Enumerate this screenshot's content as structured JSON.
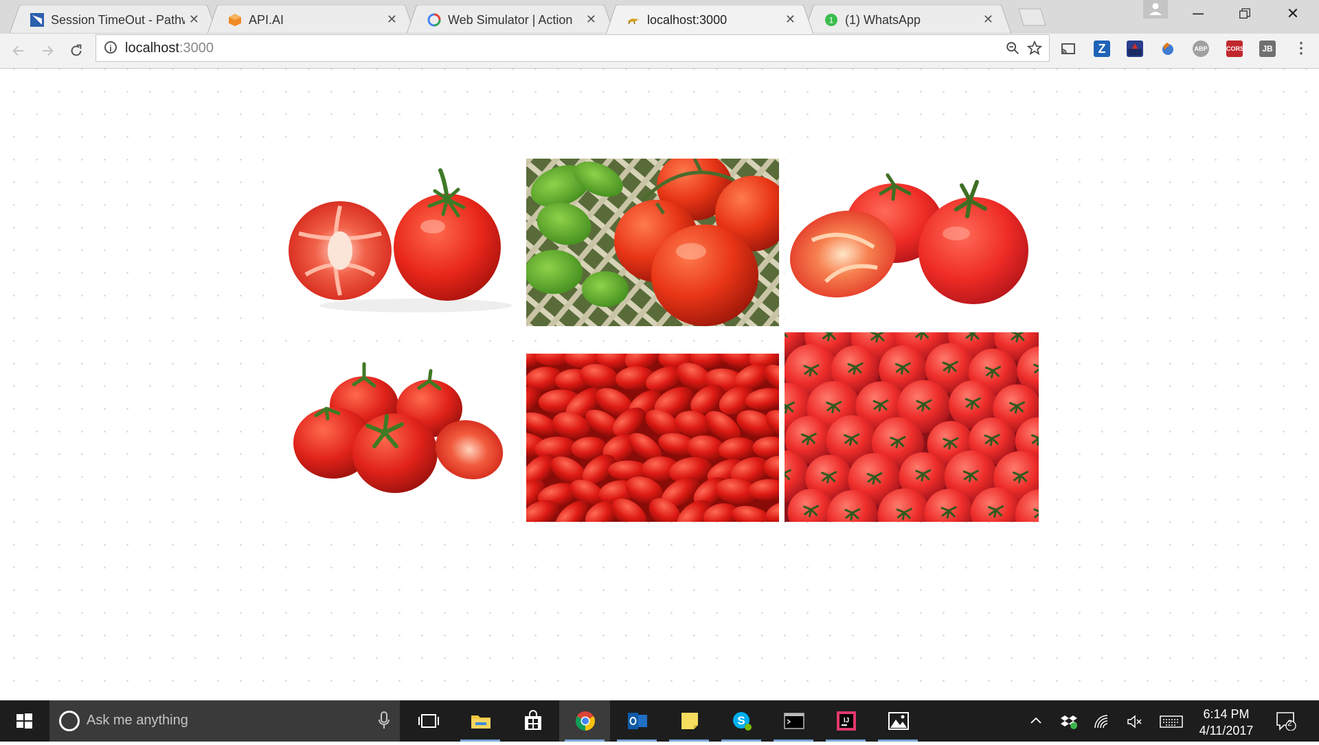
{
  "tabs": [
    {
      "title": "Session TimeOut - Pathw",
      "favicon": "pathway-icon",
      "active": false
    },
    {
      "title": "API.AI",
      "favicon": "apiai-icon",
      "active": false
    },
    {
      "title": "Web Simulator  |  Action",
      "favicon": "actions-icon",
      "active": false
    },
    {
      "title": "localhost:3000",
      "favicon": "localhost-icon",
      "active": true
    },
    {
      "title": "(1) WhatsApp",
      "favicon": "whatsapp-icon",
      "active": false
    }
  ],
  "omnibox": {
    "host": "localhost",
    "port": ":3000"
  },
  "toolbar": {
    "back_icon": "back-arrow-icon",
    "forward_icon": "forward-arrow-icon",
    "reload_icon": "reload-icon",
    "extensions": [
      {
        "name": "cast-icon",
        "label": "",
        "color": "#f2f2f2"
      },
      {
        "name": "zotero-icon",
        "label": "Z",
        "color": "#1f63b7"
      },
      {
        "name": "extension-flag-icon",
        "label": "",
        "color": "#2a3e8c"
      },
      {
        "name": "firefox-like-icon",
        "label": "",
        "color": "#e67a1e"
      },
      {
        "name": "adblock-plus-icon",
        "label": "ABP",
        "color": "#a0a0a0"
      },
      {
        "name": "cors-icon",
        "label": "CORS",
        "color": "#c0282d"
      },
      {
        "name": "jb-icon",
        "label": "JB",
        "color": "#707070"
      }
    ]
  },
  "gallery": {
    "images": [
      {
        "name": "tomato-halved-image"
      },
      {
        "name": "tomato-basil-image"
      },
      {
        "name": "tomato-cut-pair-image"
      },
      {
        "name": "cherry-tomato-cluster-image"
      },
      {
        "name": "grape-tomatoes-image"
      },
      {
        "name": "tomato-pile-image"
      }
    ]
  },
  "taskbar": {
    "search_placeholder": "Ask me anything",
    "apps": [
      {
        "name": "task-view-icon"
      },
      {
        "name": "file-explorer-icon"
      },
      {
        "name": "store-icon"
      },
      {
        "name": "chrome-icon"
      },
      {
        "name": "outlook-icon"
      },
      {
        "name": "sticky-notes-icon"
      },
      {
        "name": "skype-icon"
      },
      {
        "name": "terminal-icon"
      },
      {
        "name": "intellij-icon"
      },
      {
        "name": "photos-icon"
      }
    ],
    "time": "6:14 PM",
    "date": "4/11/2017",
    "notifications_count": "2"
  }
}
